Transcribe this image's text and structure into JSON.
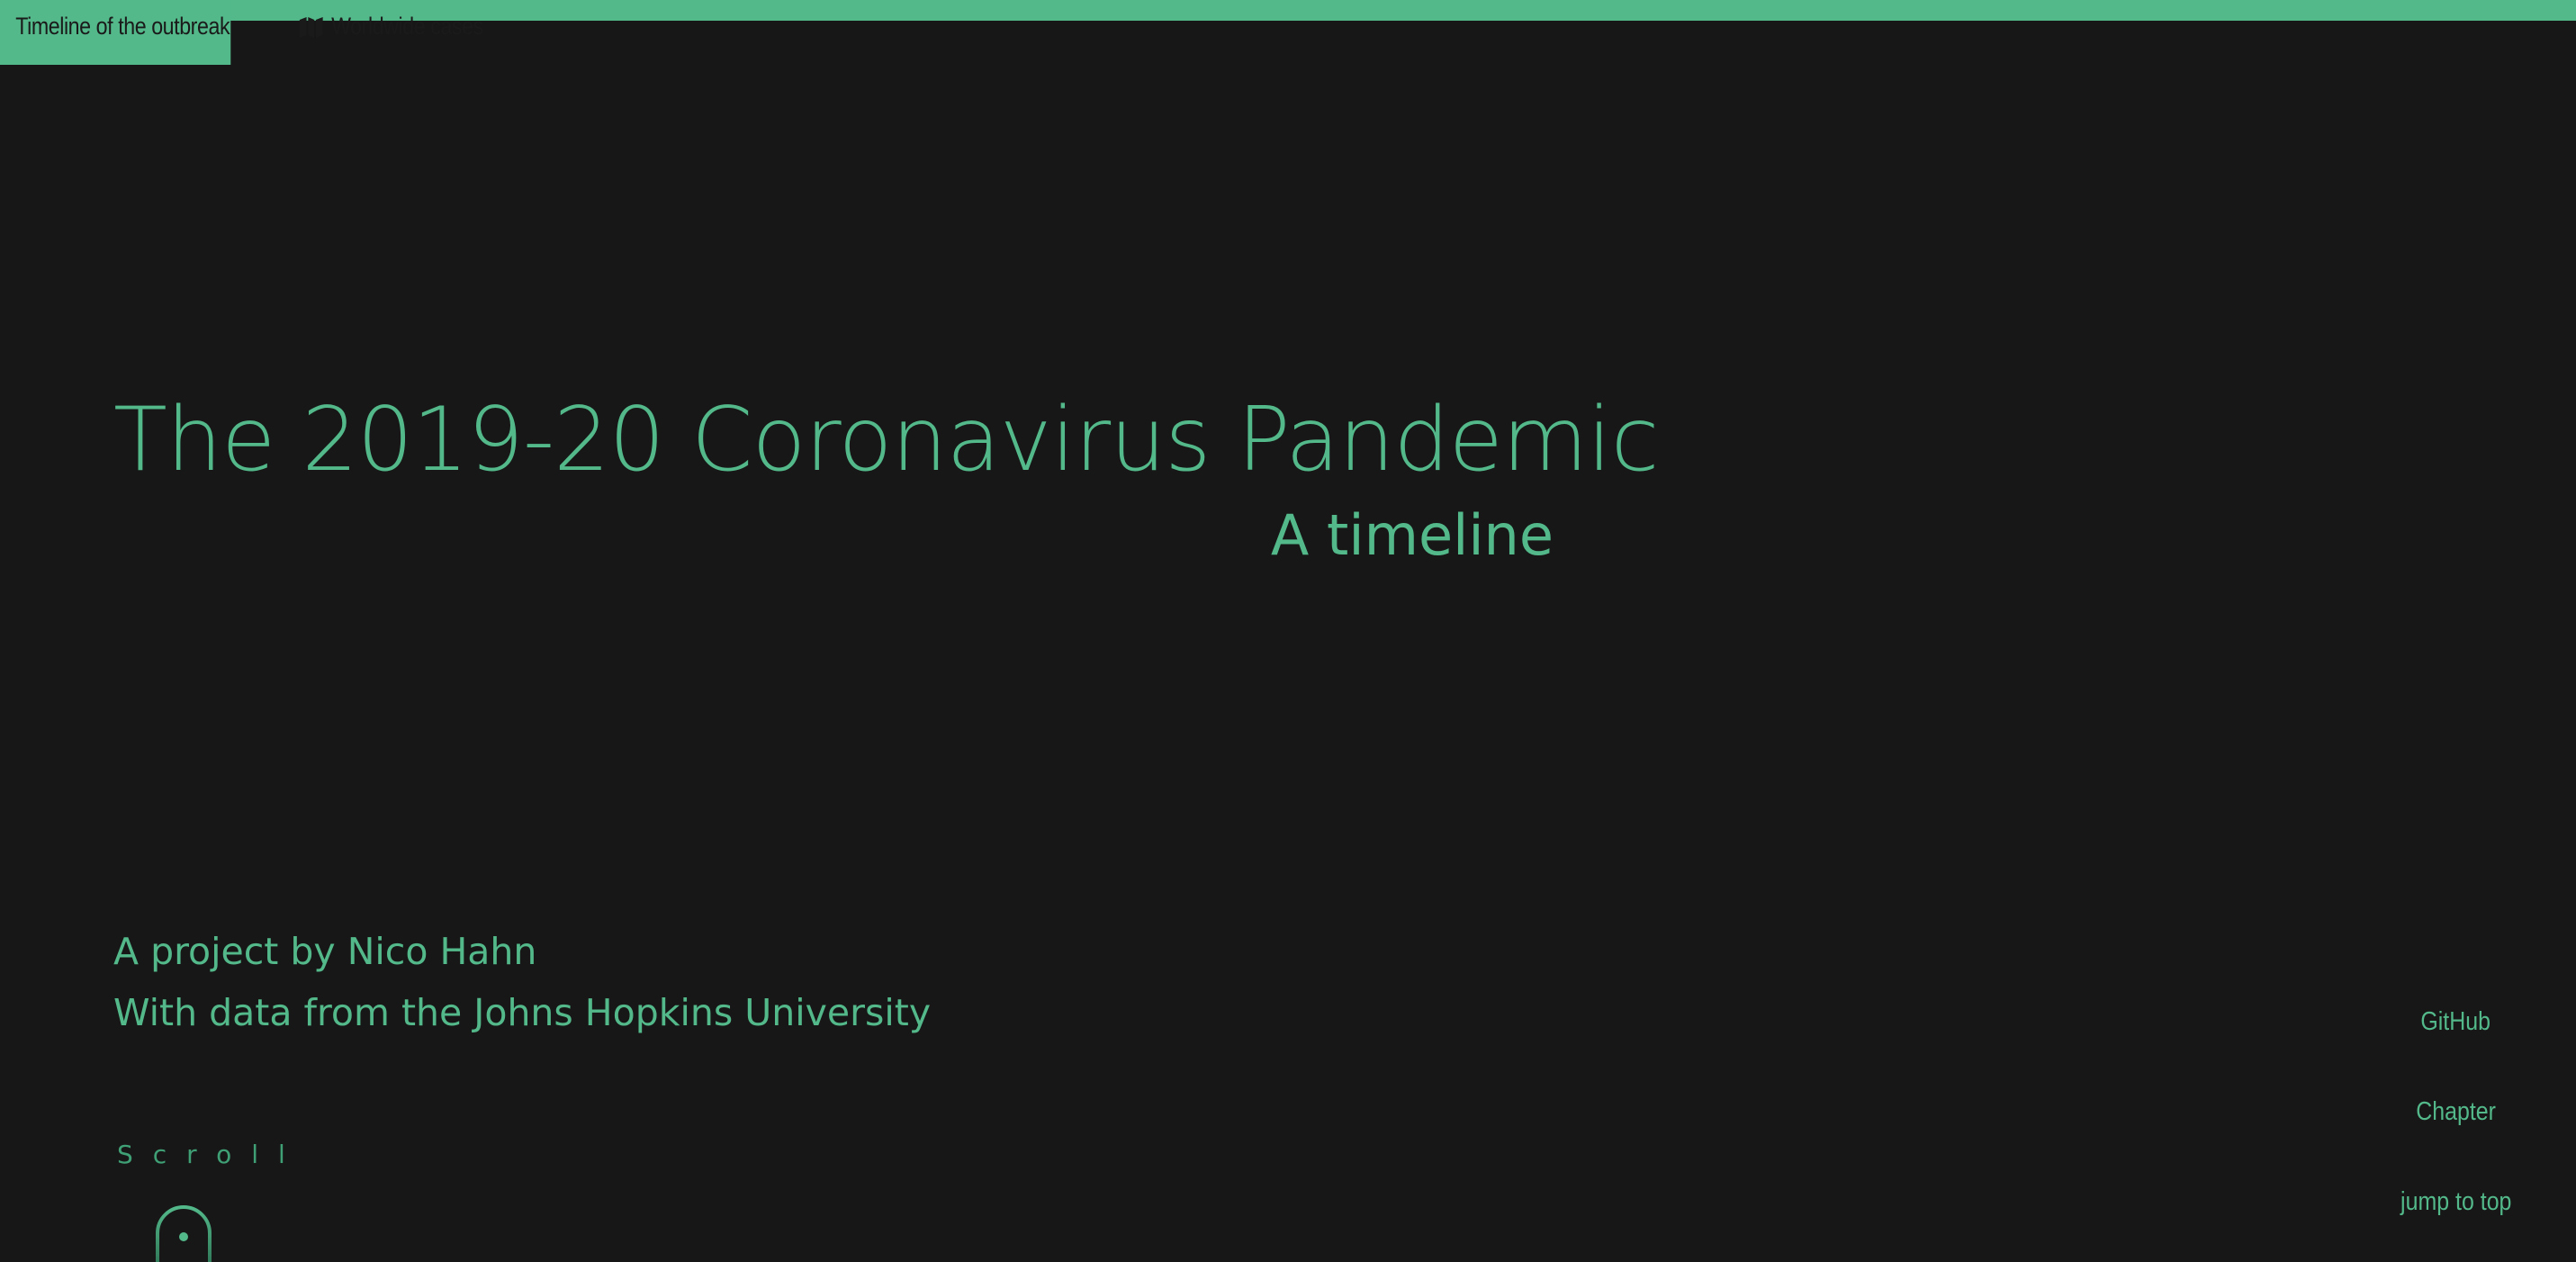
{
  "nav": {
    "tabs": [
      {
        "label": "Timeline of the outbreak",
        "active": true
      },
      {
        "label": "Worldwide cases",
        "icon": "map-icon",
        "active": false
      }
    ]
  },
  "hero": {
    "title": "The 2019-20 Coronavirus Pandemic",
    "subtitle": "A timeline"
  },
  "credits": {
    "author": "A project by Nico Hahn",
    "data_source": "With data from the Johns Hopkins University"
  },
  "scroll": {
    "label": "Scroll",
    "icon": "mouse-icon"
  },
  "side_links": [
    {
      "label": "GitHub"
    },
    {
      "label": "Chapter"
    },
    {
      "label": "jump to top"
    }
  ],
  "colors": {
    "accent": "#53b98a",
    "background": "#171717",
    "tab_text": "#1a1a1a"
  }
}
